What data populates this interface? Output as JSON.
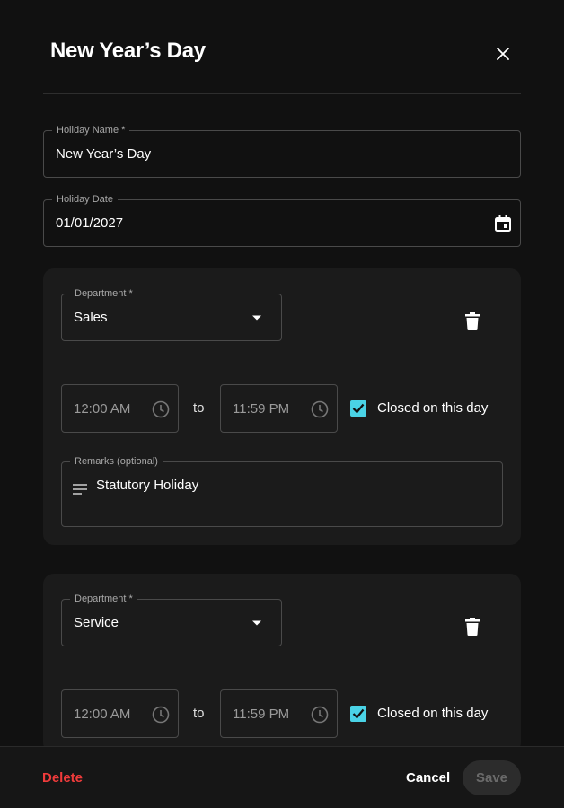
{
  "dialog": {
    "title": "New Year’s Day",
    "close_icon": "close-icon"
  },
  "holiday_name": {
    "label": "Holiday Name *",
    "value": "New Year’s Day"
  },
  "holiday_date": {
    "label": "Holiday Date",
    "value": "01/01/2027",
    "icon": "calendar-icon"
  },
  "departments": [
    {
      "department_label": "Department *",
      "department_value": "Sales",
      "start_time": "12:00 AM",
      "to_label": "to",
      "end_time": "11:59 PM",
      "closed_checked": true,
      "closed_label": "Closed on this day",
      "remarks_label": "Remarks (optional)",
      "remarks_value": "Statutory Holiday"
    },
    {
      "department_label": "Department *",
      "department_value": "Service",
      "start_time": "12:00 AM",
      "to_label": "to",
      "end_time": "11:59 PM",
      "closed_checked": true,
      "closed_label": "Closed on this day"
    }
  ],
  "footer": {
    "delete_label": "Delete",
    "cancel_label": "Cancel",
    "save_label": "Save"
  },
  "colors": {
    "background": "#111111",
    "card": "#1b1b1b",
    "accent_checkbox": "#4ad3e6",
    "danger": "#ef3b3b",
    "disabled_button": "#2c2c2c"
  }
}
